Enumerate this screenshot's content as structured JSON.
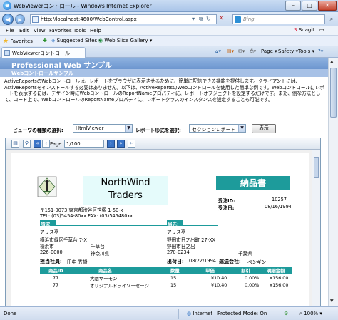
{
  "window": {
    "title": "WebViewerコントロール - Windows Internet Explorer",
    "minimize": "–",
    "maximize": "□",
    "close": "✕"
  },
  "address": {
    "url": "http://localhost:4600/WebControl.aspx",
    "search_placeholder": "Bing"
  },
  "menu": {
    "items": [
      "File",
      "Edit",
      "View",
      "Favorites",
      "Tools",
      "Help"
    ],
    "snagit": "Snagit"
  },
  "favorites": {
    "label": "Favorites",
    "suggested": "Suggested Sites ▾",
    "gallery": "Web Slice Gallery ▾"
  },
  "tab": {
    "label": "WebViewerコントロール"
  },
  "commands": {
    "page": "Page ▾",
    "safety": "Safety ▾",
    "tools": "Tools ▾",
    "help": "?▾"
  },
  "page": {
    "title": "Professional Web サンプル",
    "subtitle": "Webコントロールサンプル",
    "description": "ActiveReportsのWebコントロールは、レポートをブラウザに表示させるために、簡単に配信できる機能を提供します。クライアントには、ActiveReportsをインストールする必要はありません。以下は、ActiveReportsのWebコントロールを使用した簡単な例です。Webコントロールにレポートを表示するには、デザイン時にWebコントロールのReportNameプロパティに、レポートオブジェクトを設定するだけです。また、例な方法として、コード上で、WebコントロールのReportNameプロパティに、レポートクラスのインスタンスを設定することも可能です。",
    "viewer_type_label": "ビューワの種類の選択:",
    "viewer_type_value": "HtmlViewer",
    "report_format_label": "レポート形式を選択:",
    "report_format_value": "セクションレポート",
    "show_button": "表示"
  },
  "viewer": {
    "page_label": "Page",
    "page_value": "1/100"
  },
  "report": {
    "brand_line1": "NorthWind",
    "brand_line2": "Traders",
    "invoice_title": "納品書",
    "company_address": "〒151-0073 東京都渋谷区笹塚 1-50-x",
    "company_tel": "TEL: (03)5454-80xx   FAX: (03)545480xx",
    "customer_id_label": "受注ID:",
    "customer_id_value": "10257",
    "order_date_label": "受注日:",
    "order_date_value": "08/16/1994",
    "billto_label": "請求先:",
    "shipto_label": "届先:",
    "billto": [
      "アリス亭",
      "横浜市緑区千草台 7-X",
      "横浜市",
      "226-0000"
    ],
    "billto_extra": [
      "千草台",
      "神奈川県"
    ],
    "shipto": [
      "アリス亭",
      "野田市日之出町 27-XX",
      "野田市日之出",
      "270-0234"
    ],
    "shipto_extra": [
      "千葉県"
    ],
    "staff_label": "担当社員:",
    "staff_value": "田中 秀樹",
    "ship_date_label": "出荷日:",
    "ship_date_value": "08/22/1994",
    "carrier_label": "運送会社:",
    "carrier_value": "ペンギン",
    "table_headers": [
      "商品ID",
      "商品名",
      "数量",
      "単価",
      "割引",
      "明細金額"
    ],
    "rows": [
      [
        "77",
        "大隈サーモン",
        "15",
        "¥10.40",
        "0.00%",
        "¥156.00"
      ],
      [
        "77",
        "オリジナルドライソーセージ",
        "15",
        "¥10.40",
        "0.00%",
        "¥156.00"
      ]
    ]
  },
  "status": {
    "left": "Done",
    "zone": "Internet | Protected Mode: On",
    "zoom": "100%"
  }
}
